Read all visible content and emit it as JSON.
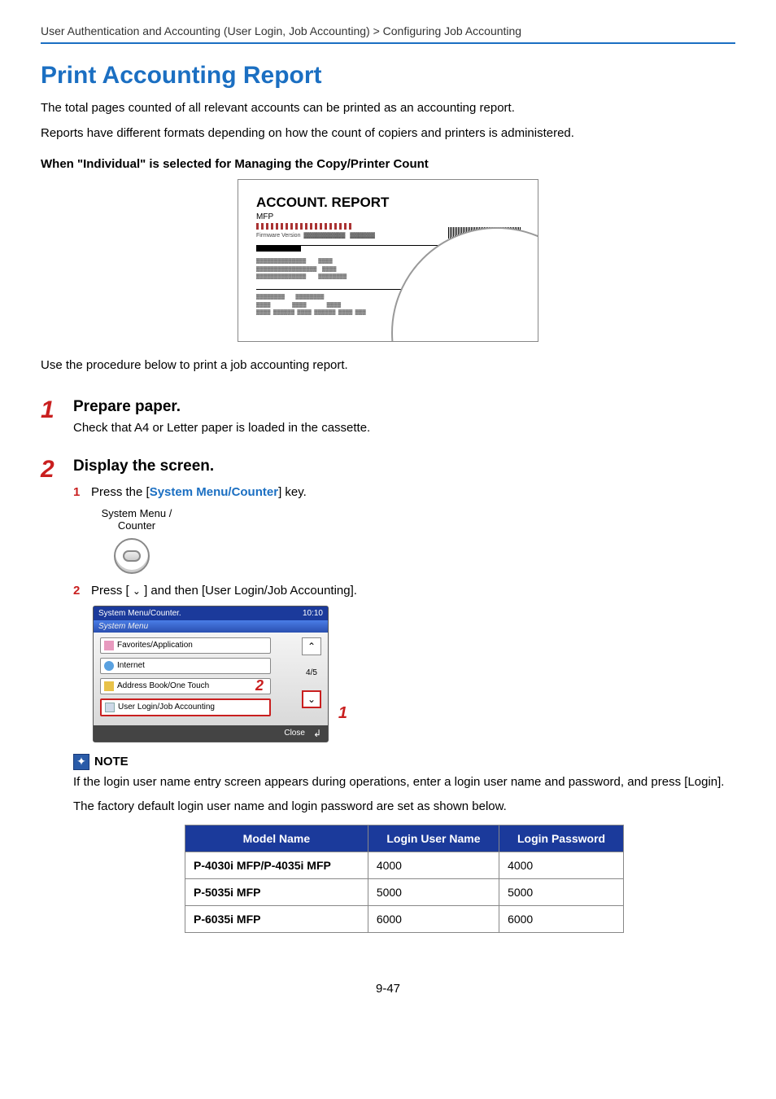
{
  "breadcrumb": "User Authentication and Accounting (User Login, Job Accounting) > Configuring Job Accounting",
  "title": "Print Accounting Report",
  "intro1": "The total pages counted of all relevant accounts can be printed as an accounting report.",
  "intro2": "Reports have different formats depending on how the count of copiers and printers is administered.",
  "subhead": "When \"Individual\" is selected for Managing the Copy/Printer Count",
  "report": {
    "title": "ACCOUNT. REPORT",
    "sub": "MFP",
    "fw": "Firmware Version"
  },
  "useprocedure": "Use the procedure below to print a job accounting report.",
  "step1": {
    "num": "1",
    "title": "Prepare paper.",
    "body": "Check that A4 or Letter paper is loaded in the cassette."
  },
  "step2": {
    "num": "2",
    "title": "Display the screen.",
    "sub1": {
      "num": "1",
      "prefix": "Press the [",
      "key": "System Menu/Counter",
      "suffix": "] key."
    },
    "keylabel": "System Menu / Counter",
    "sub2": {
      "num": "2",
      "text": "Press [     ] and then [User Login/Job Accounting]."
    }
  },
  "screen": {
    "hdr": "System Menu/Counter.",
    "time": "10:10",
    "subhdr": "System Menu",
    "items": [
      "Favorites/Application",
      "Internet",
      "Address Book/One Touch",
      "User Login/Job Accounting"
    ],
    "page": "4/5",
    "close": "Close",
    "callout_down": "1",
    "callout_item": "2"
  },
  "note": {
    "label": "NOTE",
    "text1": "If the login user name entry screen appears during operations, enter a login user name and password, and press [Login].",
    "text2": "The factory default login user name and login password are set as shown below."
  },
  "table": {
    "headers": [
      "Model Name",
      "Login User Name",
      "Login Password"
    ],
    "rows": [
      {
        "model": "P-4030i MFP/P-4035i MFP",
        "user": "4000",
        "pass": "4000"
      },
      {
        "model": "P-5035i MFP",
        "user": "5000",
        "pass": "5000"
      },
      {
        "model": "P-6035i MFP",
        "user": "6000",
        "pass": "6000"
      }
    ]
  },
  "pagenum": "9-47"
}
